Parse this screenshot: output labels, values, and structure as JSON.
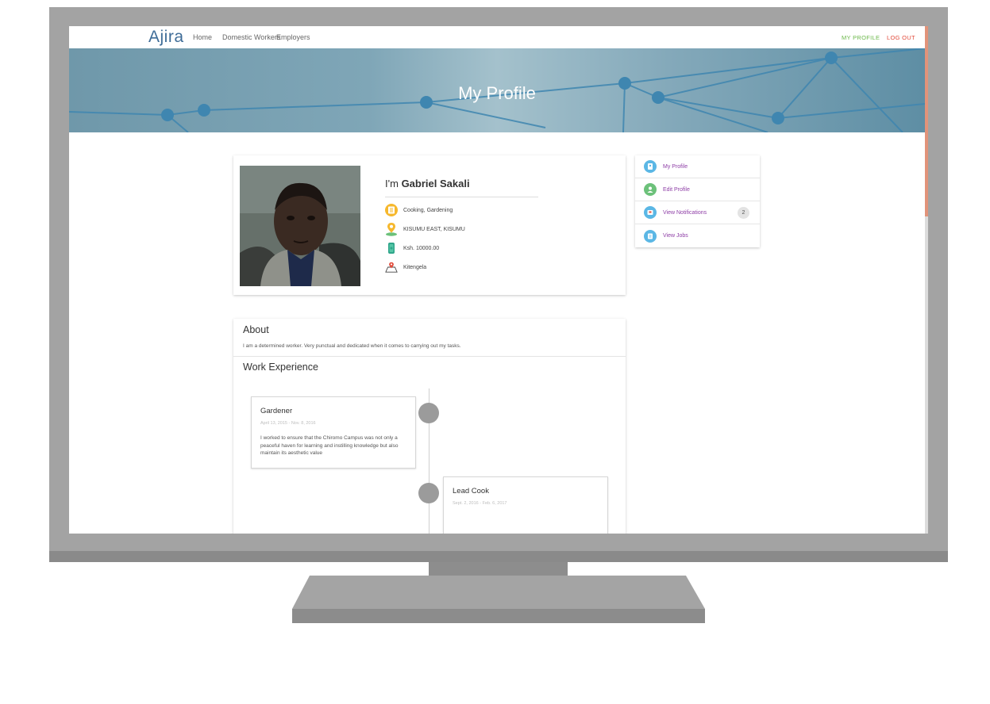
{
  "navbar": {
    "brand": "Ajira",
    "links": [
      "Home",
      "Domestic Workers",
      "Employers"
    ],
    "my_profile": "MY PROFILE",
    "logout": "LOG OUT",
    "colors": {
      "brand": "#3f6d98",
      "my_profile": "#6bb84a",
      "logout": "#e24b3b"
    }
  },
  "hero": {
    "title": "My Profile"
  },
  "profile": {
    "greeting": "I'm",
    "name": "Gabriel Sakali",
    "skills": "Cooking, Gardening",
    "location": "KISUMU EAST, KISUMU",
    "salary": "Ksh. 10000.00",
    "area": "Kitengela",
    "icons": [
      "list-icon",
      "location-pin-icon",
      "money-icon",
      "map-icon"
    ]
  },
  "menu": {
    "items": [
      {
        "label": "My Profile",
        "icon": "profile-icon",
        "color": "#5bb7e5"
      },
      {
        "label": "Edit Profile",
        "icon": "edit-profile-icon",
        "color": "#6cc17a"
      },
      {
        "label": "View Notifications",
        "icon": "notifications-icon",
        "color": "#5bb7e5",
        "badge": "2"
      },
      {
        "label": "View Jobs",
        "icon": "jobs-icon",
        "color": "#5bb7e5"
      }
    ],
    "label_color": "#8e3ea6"
  },
  "about": {
    "heading": "About",
    "text": "I am a determined worker. Very punctual and dedicated when it comes to carrying out my tasks."
  },
  "work": {
    "heading": "Work Experience",
    "items": [
      {
        "title": "Gardener",
        "dates": "April 13, 2015 - Nov. 8, 2016",
        "description": "I worked to ensure that the Chiromo Campus was not only a peaceful haven for learning and instilling knowledge but also maintain its aesthetic value"
      },
      {
        "title": "Lead Cook",
        "dates": "Sept. 2, 2016 - Feb. 6, 2017"
      }
    ]
  }
}
